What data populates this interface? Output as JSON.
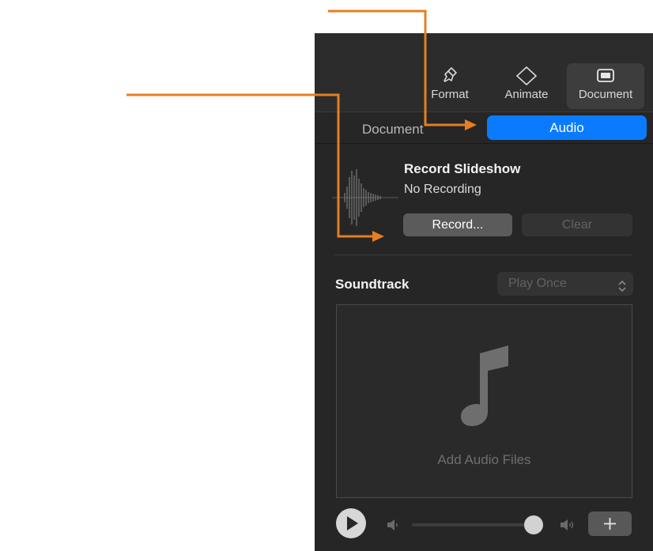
{
  "toolbar": {
    "format_label": "Format",
    "animate_label": "Animate",
    "document_label": "Document"
  },
  "tabs": {
    "document_label": "Document",
    "audio_label": "Audio"
  },
  "recording": {
    "title": "Record Slideshow",
    "status": "No Recording",
    "record_label": "Record...",
    "clear_label": "Clear"
  },
  "soundtrack": {
    "label": "Soundtrack",
    "mode": "Play Once",
    "drop_label": "Add Audio Files"
  },
  "colors": {
    "accent": "#0a7bff",
    "annotation": "#e67e22",
    "panel_bg": "#262626"
  },
  "icons": [
    "paintbrush-icon",
    "diamond-icon",
    "document-icon",
    "waveform-icon",
    "music-note-icon",
    "play-icon",
    "speaker-low-icon",
    "speaker-high-icon",
    "plus-icon",
    "chevron-updown-icon"
  ]
}
